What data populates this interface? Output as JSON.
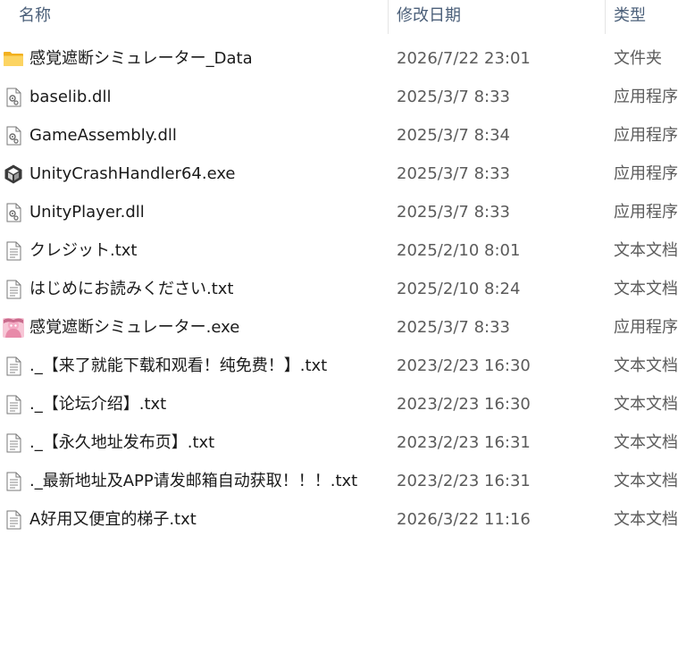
{
  "columns": {
    "name": "名称",
    "date": "修改日期",
    "type": "类型"
  },
  "files": [
    {
      "icon": "folder-icon",
      "name": "感覚遮断シミュレーター_Data",
      "date": "2026/7/22 23:01",
      "type": "文件夹"
    },
    {
      "icon": "dll-file-icon",
      "name": "baselib.dll",
      "date": "2025/3/7 8:33",
      "type": "应用程序"
    },
    {
      "icon": "dll-file-icon",
      "name": "GameAssembly.dll",
      "date": "2025/3/7 8:34",
      "type": "应用程序"
    },
    {
      "icon": "unity-logo-icon",
      "name": "UnityCrashHandler64.exe",
      "date": "2025/3/7 8:33",
      "type": "应用程序"
    },
    {
      "icon": "dll-file-icon",
      "name": "UnityPlayer.dll",
      "date": "2025/3/7 8:33",
      "type": "应用程序"
    },
    {
      "icon": "text-file-icon",
      "name": "クレジット.txt",
      "date": "2025/2/10 8:01",
      "type": "文本文档"
    },
    {
      "icon": "text-file-icon",
      "name": "はじめにお読みください.txt",
      "date": "2025/2/10 8:24",
      "type": "文本文档"
    },
    {
      "icon": "game-app-icon",
      "name": "感覚遮断シミュレーター.exe",
      "date": "2025/3/7 8:33",
      "type": "应用程序"
    },
    {
      "icon": "text-file-icon",
      "name": "._【来了就能下载和观看！纯免费！】.txt",
      "date": "2023/2/23 16:30",
      "type": "文本文档"
    },
    {
      "icon": "text-file-icon",
      "name": "._【论坛介绍】.txt",
      "date": "2023/2/23 16:30",
      "type": "文本文档"
    },
    {
      "icon": "text-file-icon",
      "name": "._【永久地址发布页】.txt",
      "date": "2023/2/23 16:31",
      "type": "文本文档"
    },
    {
      "icon": "text-file-icon",
      "name": "._最新地址及APP请发邮箱自动获取！！！.txt",
      "date": "2023/2/23 16:31",
      "type": "文本文档"
    },
    {
      "icon": "text-file-icon",
      "name": "A好用又便宜的梯子.txt",
      "date": "2026/3/22 11:16",
      "type": "文本文档"
    }
  ]
}
